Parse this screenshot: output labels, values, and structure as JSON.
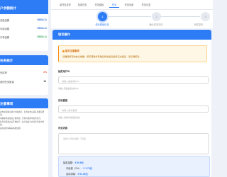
{
  "account": {
    "title": "户余额统计",
    "rows": [
      {
        "label": "充值金额",
        "value": "¥8934.11"
      },
      {
        "label": "可用余额",
        "value": "¥8934.11"
      },
      {
        "label": "订单金额",
        "value": "¥8934.11"
      }
    ]
  },
  "tasks": {
    "title": "任务统计",
    "rate_label": "完成率",
    "rate_value": "2%",
    "count_label": "我的任务数量",
    "count_value": "10"
  },
  "notes": {
    "title": "注意事项",
    "items": [
      "发布前请确认账户余额充足，任务发布后将冻结相应费用。",
      "请确保作品链接正确有效，否则可能影响任务执行。",
      "任务审核通过后开始执行，执行进度可在任务列表中查看。",
      "如有疑问请联系客服处理。"
    ]
  },
  "tabs": [
    {
      "label": "单任务发布",
      "active": false
    },
    {
      "label": "批量任务",
      "active": false
    },
    {
      "label": "任务模板",
      "active": false
    },
    {
      "label": "任务",
      "active": true
    },
    {
      "label": "任务设置",
      "active": false
    },
    {
      "label": "任务记录",
      "active": false
    }
  ],
  "steps": [
    {
      "num": "1",
      "label": "填写基础信息",
      "active": true
    },
    {
      "num": "2",
      "label": "确认任务详情",
      "active": false
    },
    {
      "num": "3",
      "label": "完成发布",
      "active": false
    }
  ],
  "panel": {
    "title": "填写操作",
    "warn_title": "填写注意事项",
    "warn_body": "请确保填写的信息准确，填写错误将导致任务失败且费用无法退还，请仔细核对。",
    "field1_label": "抽奖用户ID",
    "field1_placeholder": "请输入抽奖用户ID",
    "field1_hint": "请输入需要抽奖的用户ID",
    "field2_label": "目标链接",
    "field2_placeholder": "请输入目标链接",
    "field2_hint": "请输入完整的作品链接地址",
    "field3_label": "评论内容",
    "field3_placeholder": "请输入评论内容（可选）",
    "field3_hint": "可选，填写后将按照此内容评论，最多100个字符"
  },
  "summary": {
    "line1_label": "抽奖金额：",
    "line1_value": "¥ 89.6元",
    "line2_label": "手续费（2%）：",
    "line2_value": "¥ 1.79元",
    "line3_label": "实际扣除：",
    "line3_value": "¥ 91.39元"
  },
  "colors": {
    "primary": "#2d7cf6",
    "warning": "#fa8c16",
    "danger": "#e74c3c",
    "success": "#35a55a"
  }
}
